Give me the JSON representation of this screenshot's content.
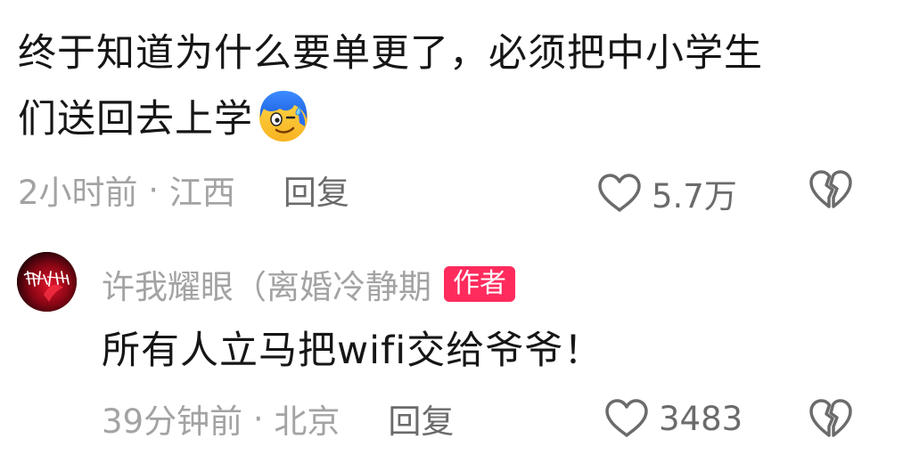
{
  "comments": [
    {
      "text_line1": "终于知道为什么要单更了，必须把中小学生",
      "text_line2": "们送回去上学",
      "emoji_icon": "sweat-smile-emoji-icon",
      "time": "2小时前",
      "separator": " · ",
      "location": "江西",
      "reply_label": "回复",
      "like_count": "5.7万"
    }
  ],
  "reply": {
    "username": "许我耀眼（离婚冷静期",
    "author_badge": "作者",
    "text": "所有人立马把wifi交给爷爷！",
    "time": "39分钟前",
    "separator": " · ",
    "location": "北京",
    "reply_label": "回复",
    "like_count": "3483"
  },
  "colors": {
    "text_primary": "#161616",
    "text_meta": "#a3a3a3",
    "text_secondary": "#6b6b6b",
    "author_badge_bg": "#ff2b5d"
  }
}
